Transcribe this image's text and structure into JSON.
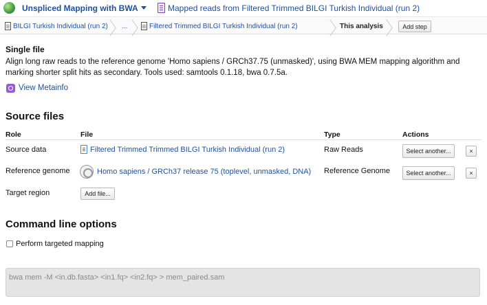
{
  "topbar": {
    "app_title": "Unspliced Mapping with BWA",
    "reads_link": "Mapped reads from Filtered Trimmed BILGI Turkish Individual (run 2)"
  },
  "breadcrumb": {
    "items": [
      "BILGI Turkish Individual (run 2)",
      "...",
      "Filtered Trimmed BILGI Turkish Individual (run 2)"
    ],
    "current": "This analysis",
    "add_step": "Add step"
  },
  "overview": {
    "heading": "Single file",
    "description": "Align long raw reads to the reference genome 'Homo sapiens / GRCh37.75 (unmasked)', using BWA MEM mapping algorithm and marking shorter split hits as secondary. Tools used: samtools 0.1.18, bwa 0.7.5a.",
    "metainfo_link": "View Metainfo"
  },
  "source_files": {
    "heading": "Source files",
    "columns": [
      "Role",
      "File",
      "Type",
      "Actions"
    ],
    "rows": [
      {
        "role": "Source data",
        "file": "Filtered Trimmed Trimmed BILGI Turkish Individual (run 2)",
        "type": "Raw Reads",
        "action": "Select another...",
        "remove": "×"
      },
      {
        "role": "Reference genome",
        "file": "Homo sapiens / GRCh37 release 75 (toplevel, unmasked, DNA)",
        "type": "Reference Genome",
        "action": "Select another...",
        "remove": "×"
      },
      {
        "role": "Target region",
        "action": "Add file..."
      }
    ]
  },
  "command_line": {
    "heading": "Command line options",
    "option_label": "Perform targeted mapping",
    "option_checked": false,
    "command": "bwa mem -M <in.db.fasta> <in1.fq> <in2.fq> > mem_paired.sam"
  }
}
